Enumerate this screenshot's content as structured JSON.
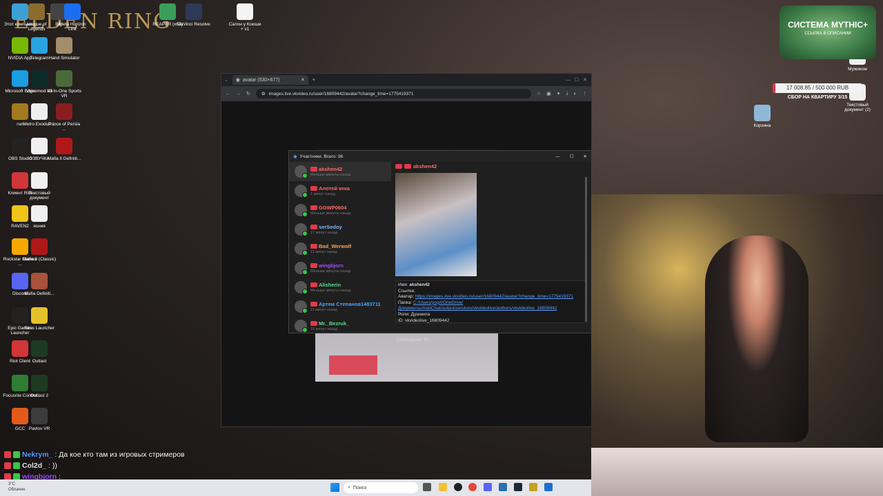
{
  "desktop": {
    "wallpaper_title": "ELDEN RING",
    "icons": [
      {
        "label": "Этот компьют...",
        "icon": "computer-icon",
        "color": "#3aa0d8"
      },
      {
        "label": "League of Legends",
        "icon": "league-icon",
        "color": "#8b6c2e"
      },
      {
        "label": "Big",
        "icon": "big-icon",
        "color": "#444444"
      },
      {
        "label": "Meta Horizon Link",
        "icon": "meta-icon",
        "color": "#1b6ef2"
      },
      {
        "label": "REAPER (x64)",
        "icon": "reaper-icon",
        "color": "#3a9d5a"
      },
      {
        "label": "DaVinci Resolve",
        "icon": "davinci-icon",
        "color": "#2c3a56"
      },
      {
        "label": "Салон у Ксюши + v1",
        "icon": "document-icon",
        "color": "#f4f4f4"
      },
      {
        "label": "NVIDIA App",
        "icon": "nvidia-icon",
        "color": "#76b900"
      },
      {
        "label": "Telegram",
        "icon": "telegram-icon",
        "color": "#2aa3df"
      },
      {
        "label": "Hand Simulator",
        "icon": "hand-icon",
        "color": "#a38d6a"
      },
      {
        "label": "Microsoft Edge",
        "icon": "edge-icon",
        "color": "#1b9de2"
      },
      {
        "label": "Voicemod V3",
        "icon": "voicemod-icon",
        "color": "#0d2a2a"
      },
      {
        "label": "All-In-One Sports VR",
        "icon": "sports-icon",
        "color": "#4a6a3a"
      },
      {
        "label": "run",
        "icon": "wow-icon",
        "color": "#a37a1e"
      },
      {
        "label": "Metro Exodus ...",
        "icon": "metro-icon",
        "color": "#eeeeee"
      },
      {
        "label": "Prince of Persia ...",
        "icon": "prince-icon",
        "color": "#8a1e1e"
      },
      {
        "label": "OBS Studio",
        "icon": "obs-icon",
        "color": "#222222"
      },
      {
        "label": "ОЗВУЧКА",
        "icon": "file-icon",
        "color": "#f0f0f0"
      },
      {
        "label": "Mafia II Definiti...",
        "icon": "mafia-icon",
        "color": "#b01818"
      },
      {
        "label": "Клиент Riot",
        "icon": "riot-icon",
        "color": "#d13639"
      },
      {
        "label": "Текстовый документ",
        "icon": "file-icon",
        "color": "#f0f0f0"
      },
      {
        "label": "RAVEN2",
        "icon": "raven-icon",
        "color": "#f0c419"
      },
      {
        "label": "Rockstar Games ...",
        "icon": "rockstar-icon",
        "color": "#f6a800"
      },
      {
        "label": "Mafia II (Classic)",
        "icon": "mafia-icon",
        "color": "#b01818"
      },
      {
        "label": "Discord",
        "icon": "discord-icon",
        "color": "#5865f2"
      },
      {
        "label": "Mafia Definiti...",
        "icon": "mafia-icon",
        "color": "#a7523a"
      },
      {
        "label": "Epic Games Launcher",
        "icon": "epic-icon",
        "color": "#222222"
      },
      {
        "label": "Sirus Launcher",
        "icon": "sirus-icon",
        "color": "#e6c22a"
      },
      {
        "label": "Riot Client",
        "icon": "riot-icon",
        "color": "#d13639"
      },
      {
        "label": "Outlast",
        "icon": "outlast-icon",
        "color": "#1f3a22"
      },
      {
        "label": "Focusrite Control",
        "icon": "focusrite-icon",
        "color": "#2e7d32"
      },
      {
        "label": "Outlast 2",
        "icon": "outlast-icon",
        "color": "#1f3a22"
      },
      {
        "label": "GCC",
        "icon": "gcc-icon",
        "color": "#e35a1a"
      },
      {
        "label": "Pavlov VR",
        "icon": "pavlov-icon",
        "color": "#3c3c3c"
      },
      {
        "label": "ясния",
        "icon": "file-icon",
        "color": "#f0f0f0"
      },
      {
        "label": "Корзина",
        "icon": "recycle-bin-icon",
        "color": "#8fb8d8"
      },
      {
        "label": "Мужиком",
        "icon": "file-icon",
        "color": "#f0f0f0"
      },
      {
        "label": "Текстовый документ (2)",
        "icon": "file-icon",
        "color": "#f0f0f0"
      }
    ]
  },
  "browser": {
    "tab_title": "avatar (530×677)",
    "url": "images.live.vkvideo.ru/user/16809442/avatar?change_time=1775419371"
  },
  "participants": {
    "window_title": "Участники. Всего: 96",
    "items": [
      {
        "name": "akshen42",
        "time": "Меньше минуты назад",
        "color": "#ff6b6b"
      },
      {
        "name": "Алотей кека",
        "time": "1 минут назад",
        "color": "#ff6b6b"
      },
      {
        "name": "GGWP0604",
        "time": "Меньше минуты назад",
        "color": "#ff6b6b"
      },
      {
        "name": "serSedoy",
        "time": "17 минут назад",
        "color": "#7fb7ff"
      },
      {
        "name": "Bad_Werwolf",
        "time": "11 минут назад",
        "color": "#ffa25a"
      },
      {
        "name": "wingbjorn",
        "time": "Меньше минуты назад",
        "color": "#a050ff"
      },
      {
        "name": "Alisherin",
        "time": "Меньше минуты назад",
        "color": "#5fdc8a"
      },
      {
        "name": "Артем Степанов1483711",
        "time": "11 минут назад",
        "color": "#4aa3ff"
      },
      {
        "name": "Mr._Bezruk_",
        "time": "16 минут назад",
        "color": "#5fdc8a"
      }
    ],
    "detail": {
      "name": "akshen42",
      "name_label": "Имя:",
      "link_label": "Ссылка:",
      "avatar_label": "Аватар:",
      "avatar_url": "https://images.live.vkvideo.ru/user/16809442/avatar?change_time=1775419371",
      "folder_label": "Папка:",
      "folder_path": "C:/Users/yogrl/OneDrive/Документы/AxelChat/output/services/vkvideolive/authors/vkvideolive_16809442",
      "roles_label": "Роли:",
      "roles": "Душнила",
      "id_label": "ID:",
      "id": "vkvideolive_16809442",
      "messages_label": "Сообщения:",
      "messages": "30"
    }
  },
  "overlay": {
    "mythic_title": "СИСТЕМА MYTHIC+",
    "mythic_sub": "ССЫЛКА В ОПИСАНИИ",
    "goal_text": "17 008.85 / 500 000 RUB",
    "goal_fraction": 0.034,
    "goal_caption": "СБОР НА КВАРТИРУ 3/15",
    "accent": "#e0344a"
  },
  "chat": [
    {
      "name": "Nekrym_",
      "text": ": Да кое кто там из игровых стримеров",
      "color": "#5aa0ff"
    },
    {
      "name": "Col2d_",
      "text": ": ))",
      "color": "#e8e8e8"
    },
    {
      "name": "wingbjorn",
      "text": ":",
      "color": "#a050ff"
    }
  ],
  "taskbar": {
    "weather_temp": "3°C",
    "weather_text": "Облачно",
    "search_placeholder": "Поиск"
  }
}
